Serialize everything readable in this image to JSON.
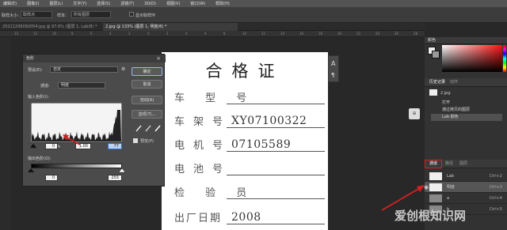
{
  "menu": [
    "编辑(E)",
    "图像(I)",
    "图层(L)",
    "文字(Y)",
    "选择(S)",
    "滤镜(T)",
    "3D(D)",
    "视图(V)",
    "窗口(W)",
    "帮助(H)"
  ],
  "options": {
    "sample_size_label": "取样大小:",
    "sample_size_value": "取样点",
    "sample_label": "样本:",
    "sample_value": "所有图层",
    "show_ring": "显示取样环"
  },
  "tabs": [
    {
      "label": "20211206092054.jpg @ 97.6% (图层 1, Lab/8) *",
      "active": false
    },
    {
      "label": "2.jpg @ 133% (图层 1, 明度/8) *",
      "active": true
    }
  ],
  "ruler": [
    "14",
    "12",
    "10",
    "8",
    "6",
    "4",
    "2",
    "0",
    "2",
    "4",
    "6",
    "8",
    "10",
    "12",
    "14",
    "16",
    "18",
    "20",
    "22",
    "24",
    "26",
    "28"
  ],
  "document": {
    "title": "合格证",
    "rows": [
      {
        "label": "车 型 号",
        "value": ""
      },
      {
        "label": "车架号",
        "value": "XY07100322"
      },
      {
        "label": "电机号",
        "value": "07105589"
      },
      {
        "label": "电池号",
        "value": ""
      },
      {
        "label": "检 验 员",
        "value": ""
      },
      {
        "label": "出厂日期",
        "value": "2008"
      }
    ]
  },
  "levels": {
    "title": "色阶",
    "preset_label": "预设(E):",
    "preset_value": "自定",
    "channel_label": "通道:",
    "channel_value": "明度",
    "input_label": "输入色阶(I):",
    "input_black": "0",
    "input_gray": "1.00",
    "input_white": "77",
    "output_label": "输出色阶(O):",
    "output_black": "0",
    "output_white": "255",
    "buttons": [
      "确定",
      "取消",
      "自动(A)",
      "选项(T)..."
    ],
    "preview_label": "预览(P)"
  },
  "color_panel": {
    "title": "颜色"
  },
  "history": {
    "tabs": [
      "历史记录",
      "动作"
    ],
    "doc": "2.jpg",
    "items": [
      "打开",
      "通过拷贝的图层",
      "Lab 颜色"
    ]
  },
  "channels": {
    "tabs": [
      "通道",
      "路径",
      "图层"
    ],
    "rows": [
      {
        "name": "Lab",
        "shortcut": "Ctrl+2"
      },
      {
        "name": "明度",
        "shortcut": "Ctrl+3"
      },
      {
        "name": "a",
        "shortcut": "Ctrl+4"
      },
      {
        "name": "b",
        "shortcut": "Ctrl+5"
      }
    ]
  },
  "watermark": "爱创根知识网",
  "colors": {
    "accent_red": "#d62020",
    "highlight_blue": "#2f6fd6"
  }
}
